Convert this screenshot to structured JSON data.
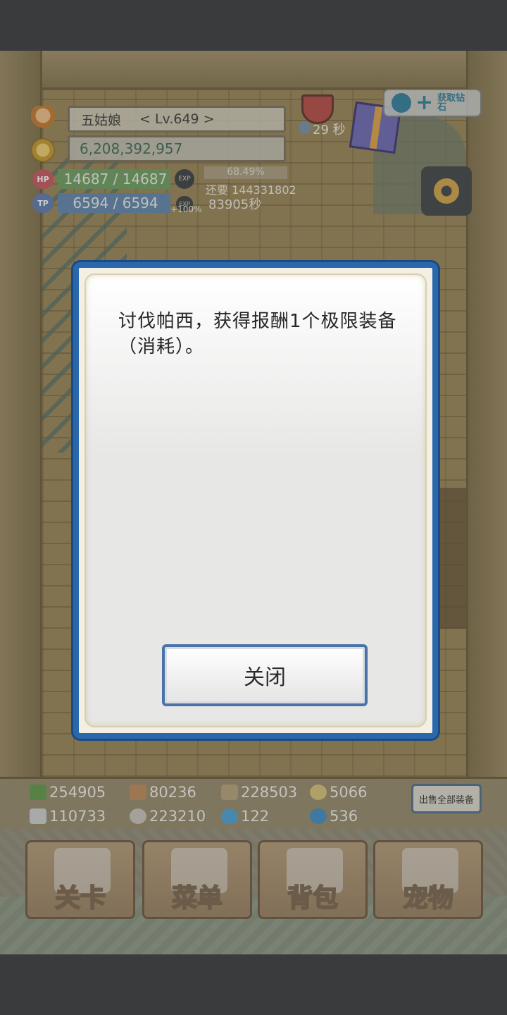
{
  "player": {
    "name": "五姑娘",
    "level": "< Lv.649 >",
    "gold": "6,208,392,957",
    "hp_label": "HP",
    "hp": "14687 / 14687",
    "tp_label": "TP",
    "tp": "6594 / 6594"
  },
  "exp": {
    "icon_label": "EXP",
    "percent": "68.49%",
    "remaining": "还要 144331802",
    "bonus": "+100%",
    "time": "83905秒"
  },
  "timer": "29 秒",
  "diamond_button": {
    "label": "获取钻石"
  },
  "resources": [
    {
      "icon": "herb-icon",
      "color": "#5e9c48",
      "value": "254905"
    },
    {
      "icon": "log-icon",
      "color": "#c08a5a",
      "value": "80236"
    },
    {
      "icon": "plank-icon",
      "color": "#b7a27c",
      "value": "228503"
    },
    {
      "icon": "seed-icon",
      "color": "#d9c27a",
      "value": "5066"
    },
    {
      "icon": "iron-icon",
      "color": "#cfd2d4",
      "value": "110733"
    },
    {
      "icon": "stone-icon",
      "color": "#c9c5c0",
      "value": "223210"
    },
    {
      "icon": "flame-icon",
      "color": "#4aa3d8",
      "value": "122"
    },
    {
      "icon": "orb-icon",
      "color": "#3d8cc6",
      "value": "536"
    }
  ],
  "sell_all_label": "出售全部装备",
  "nav": [
    {
      "label": "关卡",
      "icon": "crossed-swords-icon"
    },
    {
      "label": "菜单",
      "icon": "book-icon"
    },
    {
      "label": "背包",
      "icon": "backpack-icon"
    },
    {
      "label": "宠物",
      "icon": "dragon-icon"
    }
  ],
  "dialog": {
    "message": "讨伐帕西，获得报酬1个极限装备（消耗）。",
    "close_label": "关闭"
  }
}
